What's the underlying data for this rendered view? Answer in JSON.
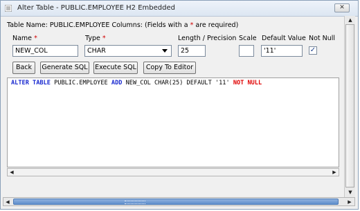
{
  "window": {
    "title": "Alter Table - PUBLIC.EMPLOYEE H2 Embedded",
    "close_glyph": "✕"
  },
  "header": {
    "table_name_prefix": "Table Name: PUBLIC.EMPLOYEE   Columns: (Fields with a ",
    "required_marker": "*",
    "table_name_suffix": " are required)"
  },
  "form": {
    "name_label": "Name",
    "type_label": "Type",
    "length_label": "Length / Precision",
    "scale_label": "Scale",
    "default_label": "Default Value",
    "notnull_label": "Not Null",
    "name_value": "NEW_COL",
    "type_value": "CHAR",
    "length_value": "25",
    "scale_value": "",
    "default_value": "'11'",
    "not_null_checked": true,
    "checkmark": "✓"
  },
  "buttons": {
    "back": "Back",
    "generate": "Generate SQL",
    "execute": "Execute SQL",
    "copy": "Copy To Editor"
  },
  "sql": {
    "kw1": "ALTER TABLE",
    "t1": " PUBLIC.EMPLOYEE ",
    "kw2": "ADD",
    "t2": " NEW_COL CHAR(25) DEFAULT '11' ",
    "kw3": "NOT NULL"
  },
  "icons": [
    "app-icon",
    "close-icon",
    "dropdown-arrow-icon",
    "scroll-left-icon",
    "scroll-right-icon",
    "scroll-up-icon",
    "scroll-down-icon"
  ]
}
